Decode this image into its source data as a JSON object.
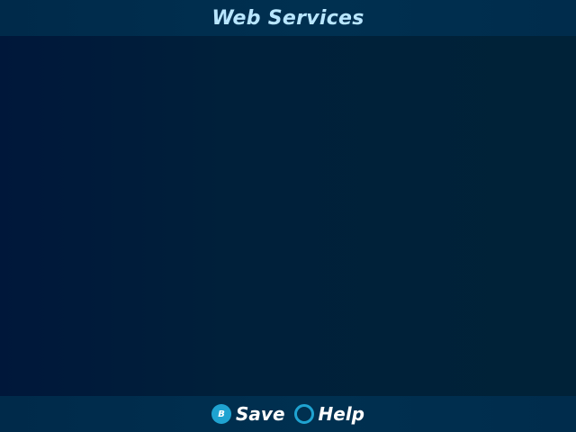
{
  "header": {
    "title": "Web Services"
  },
  "footer": {
    "hints": [
      {
        "glyph": "B",
        "glyph_icon": "b-button-icon",
        "label": "Save"
      },
      {
        "glyph": "",
        "glyph_icon": "circle-button-icon",
        "label": "Help"
      }
    ]
  },
  "colors": {
    "accent": "#1fa3d1",
    "title_text": "#b8e6ff",
    "bar_background": "#003050",
    "content_background": "#00203a"
  }
}
